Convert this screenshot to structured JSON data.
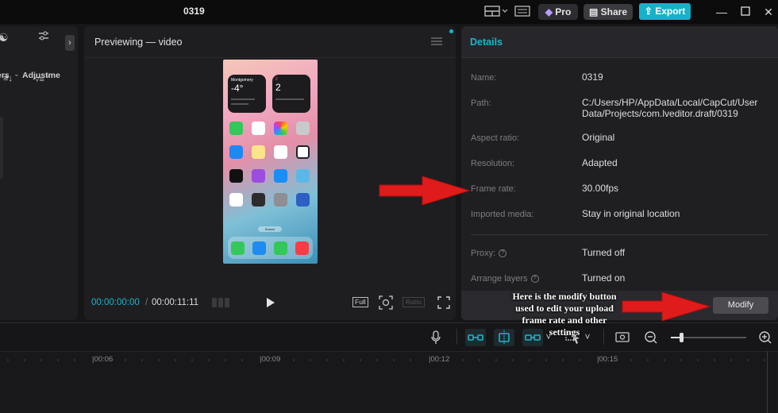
{
  "app": {
    "project_title": "0319"
  },
  "top_bar": {
    "pro_label": "Pro",
    "share_label": "Share",
    "export_label": "Export"
  },
  "left_panel": {
    "tab_filters_partial": "ers",
    "tab_adjustments_partial": "Adjustme"
  },
  "preview": {
    "title": "Previewing — video",
    "current_time": "00:00:00:00",
    "separator": "/",
    "total_time": "00:00:11:11",
    "full_label": "Full",
    "ratio_label": "Ratio"
  },
  "details": {
    "header": "Details",
    "rows": [
      {
        "label": "Name:",
        "value": "0319"
      },
      {
        "label": "Path:",
        "value": "C:/Users/HP/AppData/Local/CapCut/User Data/Projects/com.lveditor.draft/0319"
      },
      {
        "label": "Aspect ratio:",
        "value": "Original"
      },
      {
        "label": "Resolution:",
        "value": "Adapted"
      },
      {
        "label": "Frame rate:",
        "value": "30.00fps"
      },
      {
        "label": "Imported media:",
        "value": "Stay in original location"
      },
      {
        "label": "Proxy:",
        "value": "Turned off"
      },
      {
        "label": "Arrange layers",
        "value": "Turned on"
      }
    ],
    "modify_label": "Modify"
  },
  "phone_screen": {
    "weather_city": "Montgomery",
    "weather_temp": "-4°",
    "calendar_day": "2",
    "calendar_month_day": "2",
    "search_label": "Search"
  },
  "timeline": {
    "ticks": [
      "00:06",
      "00:09",
      "00:12",
      "00:15"
    ]
  },
  "annotation": {
    "text": "Here is the modify button used to edit your upload frame rate and other settings",
    "arrow_color": "#e01b1b"
  },
  "colors": {
    "accent": "#19b6cb",
    "export_bg": "#16b2c9"
  }
}
